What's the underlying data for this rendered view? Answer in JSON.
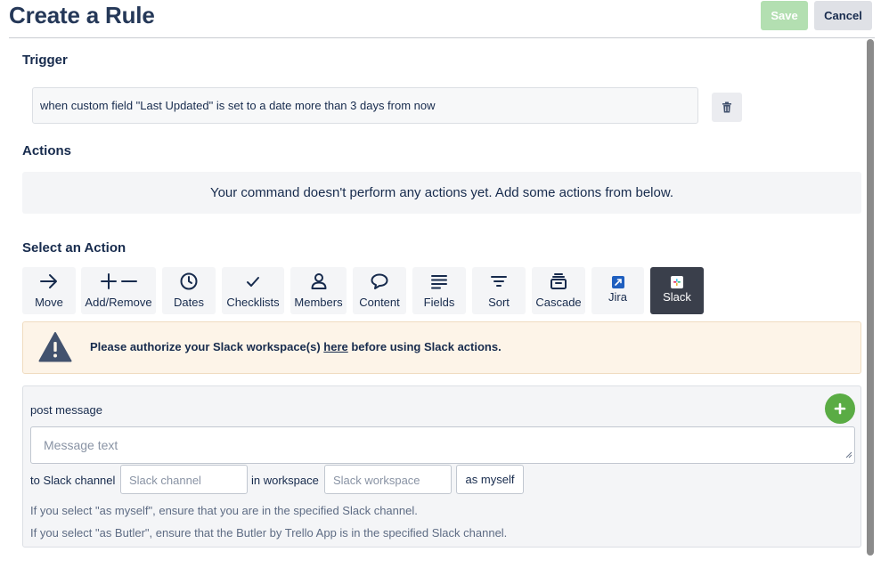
{
  "header": {
    "title": "Create a Rule",
    "save_label": "Save",
    "cancel_label": "Cancel"
  },
  "trigger": {
    "heading": "Trigger",
    "text": "when custom field \"Last Updated\" is set to a date more than 3 days from now"
  },
  "actions": {
    "heading": "Actions",
    "empty_message": "Your command doesn't perform any actions yet. Add some actions from below."
  },
  "select_action": {
    "heading": "Select an Action",
    "tabs": [
      {
        "label": "Move",
        "icon": "arrow-right-icon"
      },
      {
        "label": "Add/Remove",
        "icon": "plus-minus-icon"
      },
      {
        "label": "Dates",
        "icon": "clock-icon"
      },
      {
        "label": "Checklists",
        "icon": "checkmark-icon"
      },
      {
        "label": "Members",
        "icon": "person-icon"
      },
      {
        "label": "Content",
        "icon": "speech-bubble-icon"
      },
      {
        "label": "Fields",
        "icon": "lines-icon"
      },
      {
        "label": "Sort",
        "icon": "sort-icon"
      },
      {
        "label": "Cascade",
        "icon": "stack-icon"
      },
      {
        "label": "Jira",
        "icon": "jira-icon"
      },
      {
        "label": "Slack",
        "icon": "slack-icon",
        "active": true
      }
    ]
  },
  "warning": {
    "before": "Please authorize your Slack workspace(s) ",
    "link": "here",
    "after": " before using Slack actions."
  },
  "post_message": {
    "label": "post message",
    "message_placeholder": "Message text",
    "to_channel_label": "to Slack channel",
    "channel_placeholder": "Slack channel",
    "in_workspace_label": "in workspace",
    "workspace_placeholder": "Slack workspace",
    "as_value": "as myself",
    "hint_myself": "If you select \"as myself\", ensure that you are in the specified Slack channel.",
    "hint_butler": "If you select \"as Butler\", ensure that the Butler by Trello App is in the specified Slack channel."
  },
  "colors": {
    "save_bg": "#b3dfb1",
    "active_tab_bg": "#3a3f4b",
    "add_button": "#5aac44",
    "warning_bg": "#fdf4e8"
  }
}
